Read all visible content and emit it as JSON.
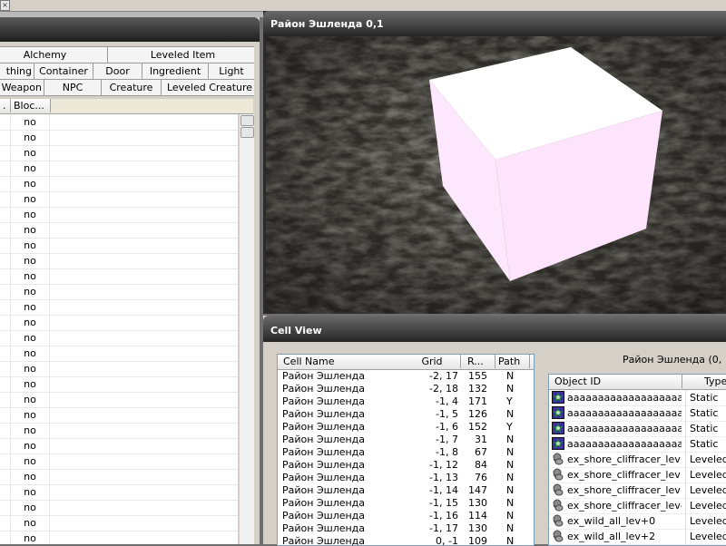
{
  "topbar": {
    "close_glyph": "×"
  },
  "object_window": {
    "tabs_row1": [
      "Alchemy",
      "Leveled Item"
    ],
    "tabs_row2": [
      "thing",
      "Container",
      "Door",
      "Ingredient",
      "Light"
    ],
    "tabs_row3": [
      "Weapon",
      "NPC",
      "Creature",
      "Leveled Creature"
    ],
    "columns": [
      ".",
      "Bloc..."
    ],
    "rows": [
      "no",
      "no",
      "no",
      "no",
      "no",
      "no",
      "no",
      "no",
      "no",
      "no",
      "no",
      "no",
      "no",
      "no",
      "no",
      "no",
      "no",
      "no",
      "no",
      "no",
      "no",
      "no",
      "no",
      "no",
      "no",
      "no",
      "no",
      "no"
    ]
  },
  "render_window": {
    "title": "Район Эшленда 0,1"
  },
  "cell_view": {
    "title": "Cell View",
    "cell_columns": [
      "Cell Name",
      "Grid",
      "R...",
      "Path"
    ],
    "cells": [
      {
        "name": "Район Эшленда",
        "grid": "-2, 17",
        "refs": "155",
        "path": "N"
      },
      {
        "name": "Район Эшленда",
        "grid": "-2, 18",
        "refs": "132",
        "path": "N"
      },
      {
        "name": "Район Эшленда",
        "grid": "-1, 4",
        "refs": "171",
        "path": "Y"
      },
      {
        "name": "Район Эшленда",
        "grid": "-1, 5",
        "refs": "126",
        "path": "N"
      },
      {
        "name": "Район Эшленда",
        "grid": "-1, 6",
        "refs": "152",
        "path": "Y"
      },
      {
        "name": "Район Эшленда",
        "grid": "-1, 7",
        "refs": "31",
        "path": "N"
      },
      {
        "name": "Район Эшленда",
        "grid": "-1, 8",
        "refs": "67",
        "path": "N"
      },
      {
        "name": "Район Эшленда",
        "grid": "-1, 12",
        "refs": "84",
        "path": "N"
      },
      {
        "name": "Район Эшленда",
        "grid": "-1, 13",
        "refs": "76",
        "path": "N"
      },
      {
        "name": "Район Эшленда",
        "grid": "-1, 14",
        "refs": "147",
        "path": "N"
      },
      {
        "name": "Район Эшленда",
        "grid": "-1, 15",
        "refs": "130",
        "path": "N"
      },
      {
        "name": "Район Эшленда",
        "grid": "-1, 16",
        "refs": "114",
        "path": "N"
      },
      {
        "name": "Район Эшленда",
        "grid": "-1, 17",
        "refs": "130",
        "path": "N"
      },
      {
        "name": "Район Эшленда",
        "grid": "0, -1",
        "refs": "109",
        "path": "N"
      }
    ],
    "selected_cell_label": "Район Эшленда (0, 1) 0",
    "ref_columns": [
      "Object ID",
      "Type"
    ],
    "refs": [
      {
        "id": "aaaaaaaaaaaaaaaaaaaa...",
        "type": "Static",
        "icon": "static-icon"
      },
      {
        "id": "aaaaaaaaaaaaaaaaaaaa...",
        "type": "Static",
        "icon": "static-icon"
      },
      {
        "id": "aaaaaaaaaaaaaaaaaaaa...",
        "type": "Static",
        "icon": "static-icon"
      },
      {
        "id": "aaaaaaaaaaaaaaaaaaaa...",
        "type": "Static",
        "icon": "static-icon"
      },
      {
        "id": "ex_shore_cliffracer_lev+0",
        "type": "Leveled",
        "icon": "leveled-creature-icon"
      },
      {
        "id": "ex_shore_cliffracer_lev+0",
        "type": "Leveled",
        "icon": "leveled-creature-icon"
      },
      {
        "id": "ex_shore_cliffracer_lev+0",
        "type": "Leveled",
        "icon": "leveled-creature-icon"
      },
      {
        "id": "ex_shore_cliffracer_lev-2",
        "type": "Leveled",
        "icon": "leveled-creature-icon"
      },
      {
        "id": "ex_wild_all_lev+0",
        "type": "Leveled",
        "icon": "leveled-creature-icon"
      },
      {
        "id": "ex_wild_all_lev+2",
        "type": "Leveled",
        "icon": "leveled-creature-icon"
      }
    ]
  }
}
